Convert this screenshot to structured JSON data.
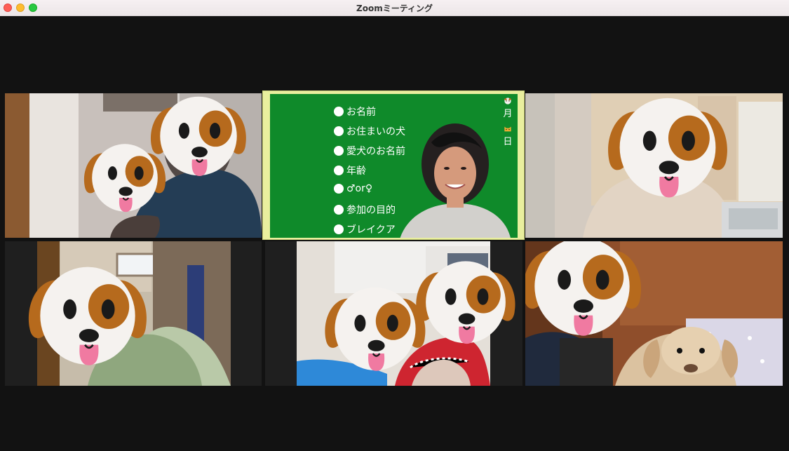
{
  "window": {
    "title": "Zoomミーティング"
  },
  "topics": [
    "お名前",
    "お住まいの犬",
    "愛犬のお名前",
    "年齢",
    "♂or♀",
    "参加の目的",
    "ブレイクア"
  ],
  "schedule": {
    "first": "月",
    "second": "日"
  },
  "icons": {
    "dog_emoji": "dog-face-icon",
    "cat_emoji": "cat-face-icon"
  },
  "colors": {
    "blackboard": "#0f8a2a",
    "blackboard_frame": "#e9ef9e",
    "meeting_background": "#121212",
    "dog_cream": "#f5f2ef",
    "dog_brown": "#b66a1d"
  }
}
